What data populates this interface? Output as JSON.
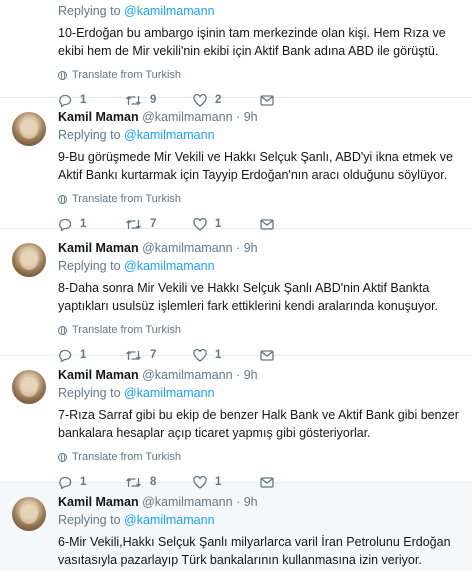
{
  "tweets": [
    {
      "name": "",
      "handle": "",
      "time": "",
      "reply_label": "Replying to",
      "reply_to": "@kamilmamann",
      "text": "10-Erdoğan bu ambargo işinin tam merkezinde olan kişi. Hem Rıza ve ekibi hem de Mir vekili'nin ekibi için Aktif Bank adına ABD ile görüştü.",
      "translate": "Translate from Turkish",
      "replies": "1",
      "retweets": "9",
      "likes": "2"
    },
    {
      "name": "Kamil Maman",
      "handle": "@kamilmamann",
      "time": "9h",
      "reply_label": "Replying to",
      "reply_to": "@kamilmamann",
      "text": "9-Bu görüşmede Mir Vekili ve Hakkı Selçuk Şanlı, ABD'yi ikna etmek ve Aktif Bankı kurtarmak için Tayyip Erdoğan'nın aracı olduğunu söylüyor.",
      "translate": "Translate from Turkish",
      "replies": "1",
      "retweets": "7",
      "likes": "1"
    },
    {
      "name": "Kamil Maman",
      "handle": "@kamilmamann",
      "time": "9h",
      "reply_label": "Replying to",
      "reply_to": "@kamilmamann",
      "text": "8-Daha sonra Mir Vekili ve Hakkı Selçuk Şanlı ABD'nin Aktif Bankta yaptıkları usulsüz işlemleri fark ettiklerini kendi aralarında konuşuyor.",
      "translate": "Translate from Turkish",
      "replies": "1",
      "retweets": "7",
      "likes": "1"
    },
    {
      "name": "Kamil Maman",
      "handle": "@kamilmamann",
      "time": "9h",
      "reply_label": "Replying to",
      "reply_to": "@kamilmamann",
      "text": "7-Rıza Sarraf gibi bu ekip de benzer Halk Bank ve Aktif Bank gibi benzer bankalara hesaplar açıp ticaret yapmış gibi gösteriyorlar.",
      "translate": "Translate from Turkish",
      "replies": "1",
      "retweets": "8",
      "likes": "1"
    },
    {
      "name": "Kamil Maman",
      "handle": "@kamilmamann",
      "time": "9h",
      "reply_label": "Replying to",
      "reply_to": "@kamilmamann",
      "text": "6-Mir Vekili,Hakkı Selçuk Şanlı milyarlarca varil İran Petrolunu Erdoğan vasıtasıyla pazarlayıp Türk bankalarının kullanmasına izin veriyor.",
      "translate": "",
      "replies": "",
      "retweets": "",
      "likes": ""
    }
  ],
  "header_separator": "·",
  "colors": {
    "link": "#1da1f2",
    "muted": "#657786",
    "border": "#e6ecf0",
    "highlight": "#f5f8fa"
  }
}
